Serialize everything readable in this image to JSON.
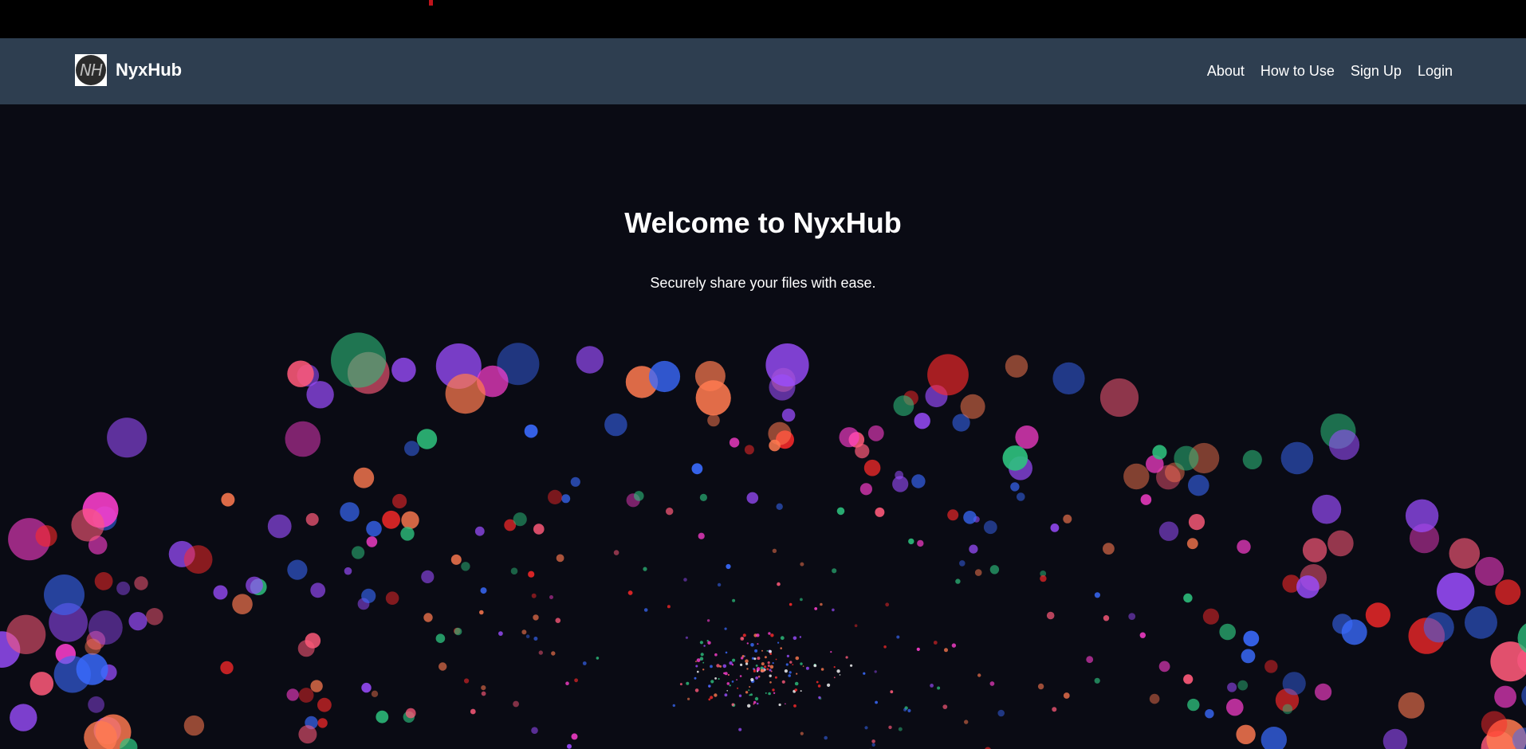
{
  "header": {
    "brand_name": "NyxHub",
    "logo_text": "NH",
    "nav": [
      {
        "label": "About"
      },
      {
        "label": "How to Use"
      },
      {
        "label": "Sign Up"
      },
      {
        "label": "Login"
      }
    ]
  },
  "hero": {
    "title": "Welcome to NyxHub",
    "subtitle": "Securely share your files with ease."
  },
  "colors": {
    "page_background": "#0a0b14",
    "navbar_background": "#2e3e50",
    "top_strip": "#000000",
    "particle_palette": [
      "#ff5a7a",
      "#ff3fd0",
      "#3a6bff",
      "#9b4dff",
      "#ff2a2a",
      "#ff7a50",
      "#2ec27e",
      "#ffffff"
    ]
  }
}
